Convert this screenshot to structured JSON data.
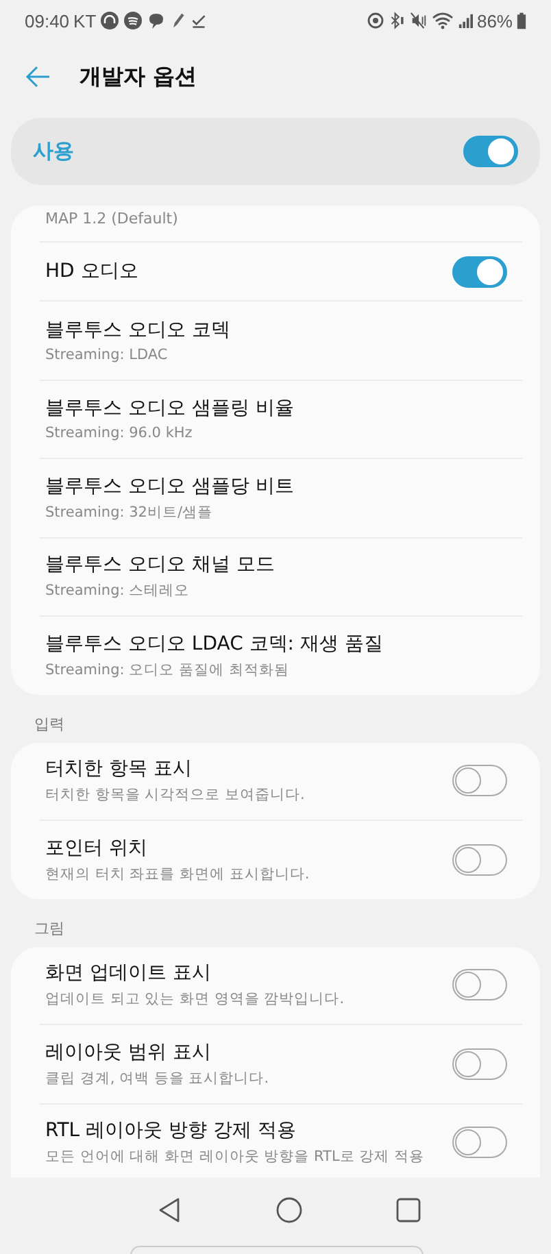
{
  "status_bar": {
    "time": "09:40",
    "carrier": "KT",
    "battery_percent": "86%"
  },
  "app_bar": {
    "title": "개발자 옵션"
  },
  "master_switch": {
    "label": "사용",
    "on": true
  },
  "sections": [
    {
      "rows": [
        {
          "kind": "caption",
          "title": "MAP 1.2 (Default)"
        },
        {
          "kind": "switch",
          "title": "HD 오디오",
          "on": true
        },
        {
          "kind": "text",
          "title": "블루투스 오디오 코덱",
          "summary": "Streaming: LDAC"
        },
        {
          "kind": "text",
          "title": "블루투스 오디오 샘플링 비율",
          "summary": "Streaming: 96.0 kHz"
        },
        {
          "kind": "text",
          "title": "블루투스 오디오 샘플당 비트",
          "summary": "Streaming: 32비트/샘플"
        },
        {
          "kind": "text",
          "title": "블루투스 오디오 채널 모드",
          "summary": "Streaming: 스테레오"
        },
        {
          "kind": "text",
          "title": "블루투스 오디오 LDAC 코덱: 재생 품질",
          "summary": "Streaming: 오디오 품질에 최적화됨"
        }
      ]
    },
    {
      "header": "입력",
      "rows": [
        {
          "kind": "switch",
          "title": "터치한 항목 표시",
          "summary": "터치한 항목을 시각적으로 보여줍니다.",
          "on": false
        },
        {
          "kind": "switch",
          "title": "포인터 위치",
          "summary": "현재의 터치 좌표를 화면에 표시합니다.",
          "on": false
        }
      ]
    },
    {
      "header": "그림",
      "rows": [
        {
          "kind": "switch",
          "title": "화면 업데이트 표시",
          "summary": "업데이트 되고 있는 화면 영역을 깜박입니다.",
          "on": false
        },
        {
          "kind": "switch",
          "title": "레이아웃 범위 표시",
          "summary": "클립 경계, 여백 등을 표시합니다.",
          "on": false
        },
        {
          "kind": "switch",
          "title": "RTL 레이아웃 방향 강제 적용",
          "summary": "모든 언어에 대해 화면 레이아웃 방향을 RTL로 강제 적용",
          "on": false
        }
      ]
    }
  ]
}
